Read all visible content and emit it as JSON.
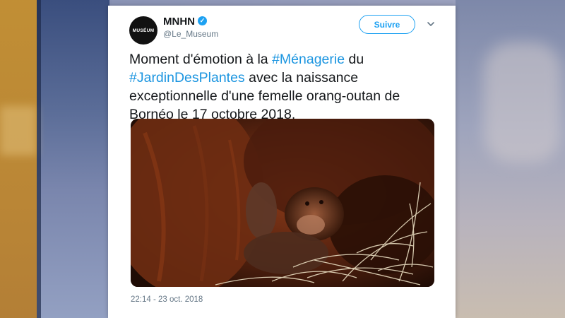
{
  "tweet": {
    "account_name": "MNHN",
    "avatar_text": "MUSÉUM",
    "handle": "@Le_Museum",
    "follow_label": "Suivre",
    "text_parts": [
      {
        "text": "Moment d'émotion à la ",
        "hashtag": false
      },
      {
        "text": "#Ménagerie",
        "hashtag": true
      },
      {
        "text": " du ",
        "hashtag": false
      },
      {
        "text": "#JardinDesPlantes",
        "hashtag": true
      },
      {
        "text": " avec la naissance exceptionnelle d'une femelle orang-outan de Bornéo le 17 octobre 2018.",
        "hashtag": false
      }
    ],
    "media_description": "Bébé orang-outan blotti contre sa mère sur de la paille",
    "timestamp": "22:14 - 23 oct. 2018"
  },
  "colors": {
    "link": "#1b95e0",
    "verified": "#1da1f2",
    "follow_border": "#1da1f2"
  },
  "icons": [
    "verified-badge-icon",
    "chevron-down-icon"
  ]
}
